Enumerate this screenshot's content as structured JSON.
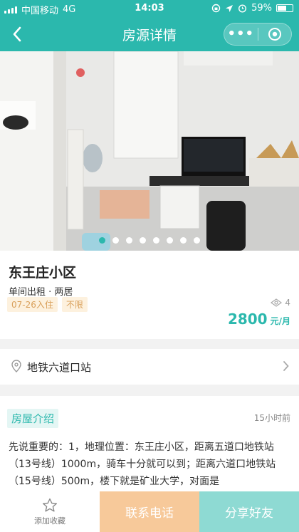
{
  "status_bar": {
    "carrier": "中国移动",
    "network": "4G",
    "time": "14:03",
    "battery": "59%"
  },
  "nav": {
    "title": "房源详情",
    "more_label": "•••"
  },
  "carousel": {
    "total": 8,
    "active_index": 0
  },
  "listing": {
    "title": "东王庄小区",
    "subtitle": "单间出租 · 两居",
    "tags": [
      "07-26入住",
      "不限"
    ],
    "view_count": "4",
    "price": "2800",
    "price_unit": "元/月"
  },
  "location": {
    "label": "地铁六道口站"
  },
  "description": {
    "section_title": "房屋介绍",
    "time_ago": "15小时前",
    "text": "先说重要的：1，地理位置：东王庄小区，距离五道口地铁站（13号线）1000m，骑车十分就可以到；距离六道口地铁站（15号线）500m，楼下就是矿业大学，对面是"
  },
  "bottom_bar": {
    "favorite_label": "添加收藏",
    "call_label": "联系电话",
    "share_label": "分享好友"
  },
  "colors": {
    "accent": "#2bb8ad",
    "call_button": "#f7c99a",
    "share_button": "#8edad3",
    "tag_bg": "#fdf1de",
    "tag_text": "#d9a05b"
  }
}
